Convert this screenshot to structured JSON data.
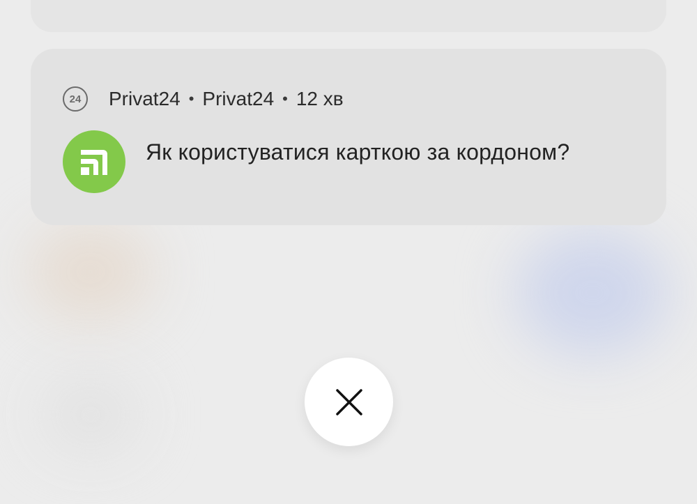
{
  "notification": {
    "app_badge": "24",
    "app_name": "Privat24",
    "channel": "Privat24",
    "separator": "•",
    "time": "12 хв",
    "message": "Як користуватися карткою за кордоном?",
    "app_icon": "privat24-logo-icon",
    "accent_color": "#83c94a"
  },
  "controls": {
    "close_icon": "close-icon"
  }
}
